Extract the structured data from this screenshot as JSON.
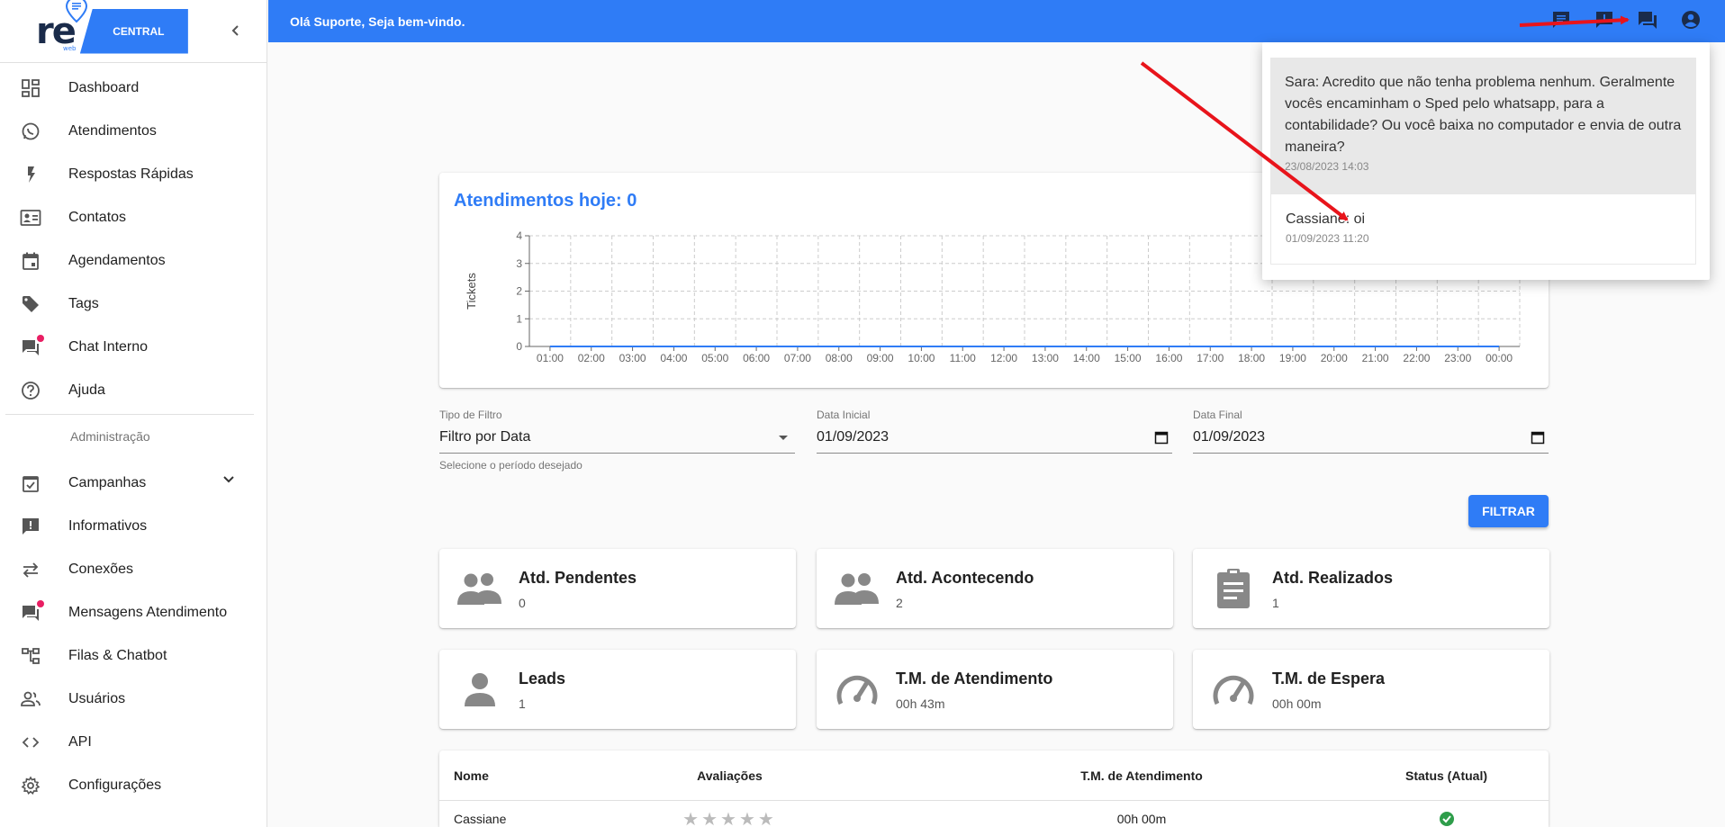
{
  "sidebar": {
    "brand": "re",
    "brand_small": "web",
    "brand_tag": "CENTRAL",
    "items": [
      {
        "label": "Dashboard"
      },
      {
        "label": "Atendimentos"
      },
      {
        "label": "Respostas Rápidas"
      },
      {
        "label": "Contatos"
      },
      {
        "label": "Agendamentos"
      },
      {
        "label": "Tags"
      },
      {
        "label": "Chat Interno"
      },
      {
        "label": "Ajuda"
      }
    ],
    "section_admin": "Administração",
    "admin_items": [
      {
        "label": "Campanhas"
      },
      {
        "label": "Informativos"
      },
      {
        "label": "Conexões"
      },
      {
        "label": "Mensagens Atendimento"
      },
      {
        "label": "Filas & Chatbot"
      },
      {
        "label": "Usuários"
      },
      {
        "label": "API"
      },
      {
        "label": "Configurações"
      }
    ]
  },
  "header": {
    "welcome": "Olá Suporte, Seja bem-vindo.",
    "icons": [
      "message-icon",
      "announcement-icon",
      "forum-icon",
      "account-circle-icon"
    ]
  },
  "chart": {
    "title": "Atendimentos hoje: 0"
  },
  "chart_data": {
    "type": "line",
    "title": "Atendimentos hoje: 0",
    "xlabel": "",
    "ylabel": "Tickets",
    "ylim": [
      0,
      4
    ],
    "yticks": [
      "0",
      "1",
      "2",
      "3",
      "4"
    ],
    "categories": [
      "01:00",
      "02:00",
      "03:00",
      "04:00",
      "05:00",
      "06:00",
      "07:00",
      "08:00",
      "09:00",
      "10:00",
      "11:00",
      "12:00",
      "13:00",
      "14:00",
      "15:00",
      "16:00",
      "17:00",
      "18:00",
      "19:00",
      "20:00",
      "21:00",
      "22:00",
      "23:00",
      "00:00"
    ],
    "values": [
      0,
      0,
      0,
      0,
      0,
      0,
      0,
      0,
      0,
      0,
      0,
      0,
      0,
      0,
      0,
      0,
      0,
      0,
      0,
      0,
      0,
      0,
      0,
      0
    ],
    "grid": true
  },
  "filters": {
    "type_label": "Tipo de Filtro",
    "type_value": "Filtro por Data",
    "type_help": "Selecione o período desejado",
    "start_label": "Data Inicial",
    "start_value": "01/09/2023",
    "end_label": "Data Final",
    "end_value": "01/09/2023",
    "button": "FILTRAR"
  },
  "stats": [
    {
      "title": "Atd. Pendentes",
      "value": "0",
      "icon": "group-icon"
    },
    {
      "title": "Atd. Acontecendo",
      "value": "2",
      "icon": "group-icon"
    },
    {
      "title": "Atd. Realizados",
      "value": "1",
      "icon": "assignment-icon"
    },
    {
      "title": "Leads",
      "value": "1",
      "icon": "person-icon"
    },
    {
      "title": "T.M. de Atendimento",
      "value": "00h 43m",
      "icon": "speed-icon"
    },
    {
      "title": "T.M. de Espera",
      "value": "00h 00m",
      "icon": "speed-icon"
    }
  ],
  "table": {
    "headers": [
      "Nome",
      "Avaliações",
      "T.M. de Atendimento",
      "Status (Atual)"
    ],
    "rows": [
      {
        "name": "Cassiane",
        "rating": "",
        "avg_time": "00h 00m",
        "status": "online"
      }
    ]
  },
  "popup": {
    "messages": [
      {
        "text": "Sara: Acredito que não tenha problema nenhum. Geralmente vocês encaminham o Sped pelo whatsapp, para a contabilidade? Ou você baixa no computador e envia de outra maneira?",
        "time": "23/08/2023 14:03"
      },
      {
        "text": "Cassiane: oi",
        "time": "01/09/2023 11:20"
      }
    ]
  },
  "colors": {
    "primary": "#2f7cf6",
    "badge": "#e91e63",
    "arrow": "#e8141b",
    "status_online": "#2e9d4a"
  }
}
